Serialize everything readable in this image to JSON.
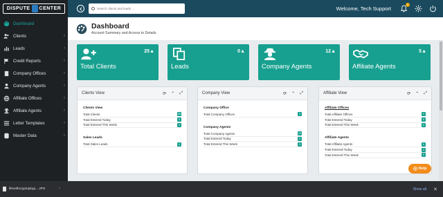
{
  "app": {
    "logo_left": "DISPUTE",
    "logo_right": "CENTER"
  },
  "header": {
    "search_placeholder": "Search clients and leads ...",
    "welcome": "Welcome, Tech Support",
    "notification_count": "0",
    "icons": [
      "back-icon",
      "bell-icon",
      "gear-icon",
      "power-icon"
    ]
  },
  "sidebar": {
    "items": [
      {
        "label": "Dashboard",
        "icon": "palette-icon",
        "active": true
      },
      {
        "label": "Clients",
        "icon": "users-icon"
      },
      {
        "label": "Leads",
        "icon": "bars-icon"
      },
      {
        "label": "Credit Reports",
        "icon": "flag-icon"
      },
      {
        "label": "Company Offices",
        "icon": "building-icon"
      },
      {
        "label": "Company Agents",
        "icon": "user-icon"
      },
      {
        "label": "Affiliate Offices",
        "icon": "globe-icon"
      },
      {
        "label": "Affiliate Agents",
        "icon": "user-secret-icon"
      },
      {
        "label": "Letter Templates",
        "icon": "list-icon"
      },
      {
        "label": "Master Data",
        "icon": "database-icon"
      }
    ]
  },
  "page": {
    "title": "Dashboard",
    "subtitle": "Account Summary and Access to Details."
  },
  "stats": [
    {
      "label": "Total Clients",
      "count": "25",
      "icon": "user-plus-icon"
    },
    {
      "label": "Leads",
      "count": "0",
      "icon": "copy-icon"
    },
    {
      "label": "Company Agents",
      "count": "12",
      "icon": "user-secret-icon"
    },
    {
      "label": "Affiliate Agents",
      "count": "5",
      "icon": "handshake-icon"
    }
  ],
  "panels": {
    "clients": {
      "title": "Clients View",
      "sections": [
        {
          "heading": "Clients View",
          "rows": [
            {
              "label": "Total Clients",
              "value": "25"
            },
            {
              "label": "Total Entered Today",
              "value": "0"
            },
            {
              "label": "Total Entered This Week",
              "value": "1"
            }
          ]
        },
        {
          "heading": "Sales Leads",
          "rows": [
            {
              "label": "Total Sales Leads",
              "value": "0"
            }
          ]
        }
      ]
    },
    "company": {
      "title": "Company View",
      "sections": [
        {
          "heading": "Company Office",
          "rows": [
            {
              "label": "Total Company Offices",
              "value": "0"
            }
          ]
        },
        {
          "heading": "Company Agents",
          "rows": [
            {
              "label": "Total Company Agents",
              "value": "12"
            },
            {
              "label": "Total Entered Today",
              "value": "0"
            },
            {
              "label": "Total Entered This Week",
              "value": "0"
            }
          ]
        }
      ]
    },
    "affiliate": {
      "title": "Affiliate View",
      "sections": [
        {
          "heading": "Affiliate Offices",
          "rows": [
            {
              "label": "Total Affiliate Offices",
              "value": "0"
            },
            {
              "label": "Total Entered Today",
              "value": "0"
            },
            {
              "label": "Total Entered This Week",
              "value": "0"
            }
          ]
        },
        {
          "heading": "Affiliate Agents",
          "rows": [
            {
              "label": "Total Affiliate Agents",
              "value": "5"
            },
            {
              "label": "Total Entered Today",
              "value": "0"
            },
            {
              "label": "Total Entered This Week",
              "value": "0"
            }
          ]
        }
      ]
    },
    "tools": [
      "refresh-icon",
      "collapse-icon",
      "expand-icon"
    ]
  },
  "help": {
    "label": "Help"
  },
  "download_bar": {
    "filename": "lifewithcryptoplugi....JPG",
    "show_all": "Show all"
  },
  "colors": {
    "accent": "#17a08f",
    "header": "#1b4a5f",
    "sidebar": "#1e2124",
    "help": "#f28c1b"
  }
}
